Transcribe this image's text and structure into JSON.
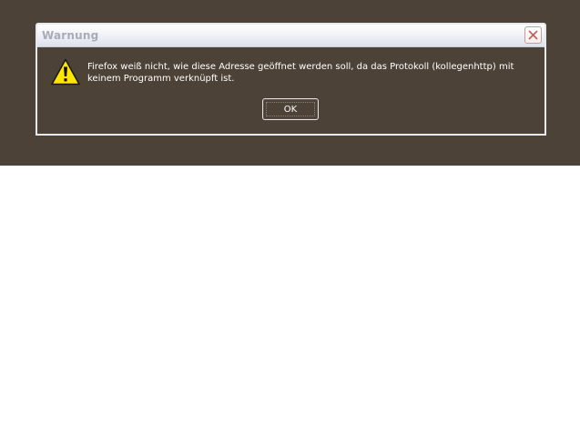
{
  "dialog": {
    "title": "Warnung",
    "message": "Firefox weiß nicht, wie diese Adresse geöffnet werden soll, da das Protokoll (kollegenhttp) mit keinem Programm verknüpft ist.",
    "ok_label": "OK",
    "icon": "warning-icon",
    "close_icon": "close-icon"
  },
  "colors": {
    "backdrop": "#4d4237",
    "title_text": "#a7acb8",
    "message_text": "#ffffff",
    "close_x": "#c0605a",
    "warning_fill": "#ffe500"
  }
}
